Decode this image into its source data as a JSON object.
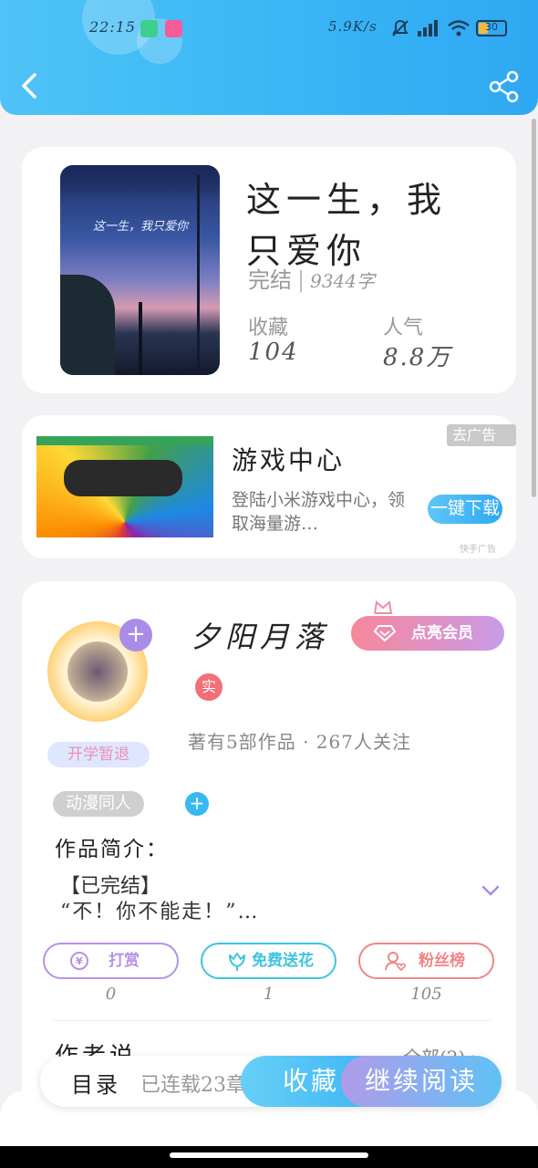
{
  "status_bar": {
    "time": "22:15",
    "net_speed": "5.9K/s",
    "battery": "30"
  },
  "book": {
    "title_line1": "这一生，我",
    "title_line2": "只爱你",
    "status": "完结",
    "word_count": "9344字",
    "fav_label": "收藏",
    "fav_value": "104",
    "pop_label": "人气",
    "pop_value": "8.8万",
    "cover_text": "这一生，我只爱你"
  },
  "ad": {
    "title": "游戏中心",
    "desc": "登陆小米游戏中心，领取海量游…",
    "close_label": "去广告",
    "button_label": "一键下载",
    "source": "快手广告"
  },
  "author": {
    "name": "夕阳月落",
    "vip_label": "点亮会员",
    "badge": "实",
    "avatar_tag": "开学暂退",
    "meta": "著有5部作品 · 267人关注"
  },
  "tags": [
    "动漫同人"
  ],
  "intro": {
    "heading": "作品简介：",
    "line1": "【已完结】",
    "line2": "“不！你不能走！”…"
  },
  "actions": [
    {
      "label": "打赏",
      "count": "0",
      "color": "#b592e6"
    },
    {
      "label": "免费送花",
      "count": "1",
      "color": "#3cc4e0"
    },
    {
      "label": "粉丝榜",
      "count": "105",
      "color": "#f08686"
    }
  ],
  "author_says": {
    "heading": "作者说",
    "all_label": "全部(2)"
  },
  "bottom": {
    "toc_label": "目录",
    "serial_text": "已连载23章",
    "fav_label": "收藏",
    "read_label": "继续阅读"
  }
}
